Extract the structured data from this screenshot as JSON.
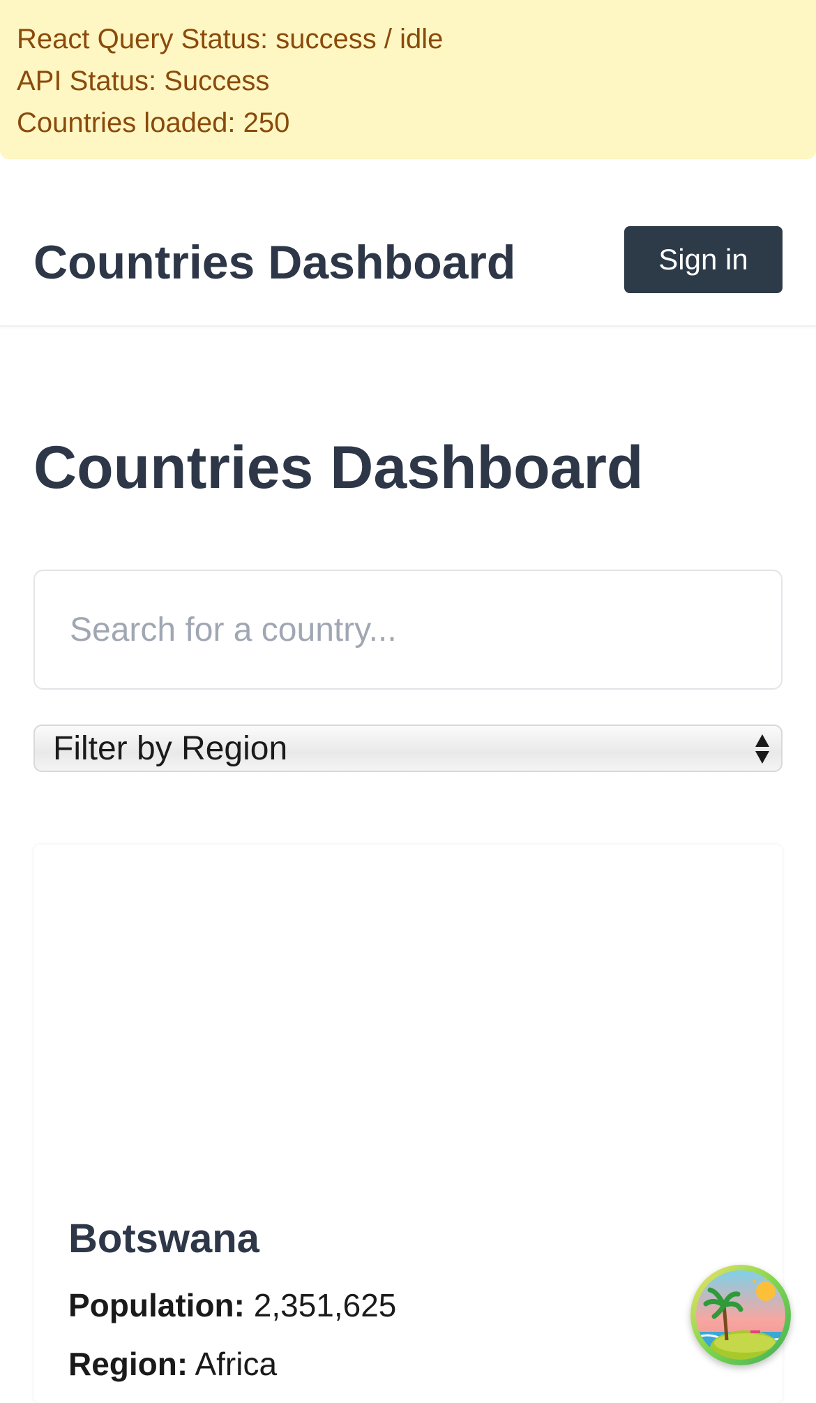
{
  "debug": {
    "query_status": "React Query Status: success / idle",
    "api_status": "API Status: Success",
    "countries_loaded": "Countries loaded: 250"
  },
  "header": {
    "title": "Countries Dashboard",
    "signin_label": "Sign in"
  },
  "main": {
    "heading": "Countries Dashboard",
    "search": {
      "placeholder": "Search for a country...",
      "value": ""
    },
    "region_filter": {
      "selected": "Filter by Region"
    },
    "country_card": {
      "name": "Botswana",
      "population_label": "Population:",
      "population_value": "2,351,625",
      "region_label": "Region:",
      "region_value": "Africa"
    }
  },
  "fab": {
    "icon": "island-beach-icon"
  },
  "colors": {
    "banner_bg": "#fef7c3",
    "banner_text": "#8a4a0b",
    "primary_text": "#2d3748",
    "button_bg": "#2d3a48"
  }
}
